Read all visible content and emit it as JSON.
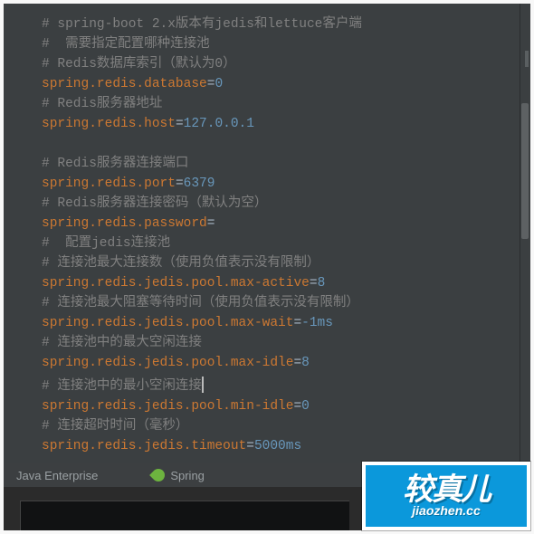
{
  "lines": [
    {
      "type": "comment",
      "text": "# spring-boot 2.x版本有jedis和lettuce客户端"
    },
    {
      "type": "comment",
      "text": "#  需要指定配置哪种连接池"
    },
    {
      "type": "comment",
      "text": "# Redis数据库索引（默认为0）"
    },
    {
      "type": "prop",
      "key": "spring.redis.database",
      "val": "0"
    },
    {
      "type": "comment",
      "text": "# Redis服务器地址"
    },
    {
      "type": "prop",
      "key": "spring.redis.host",
      "val": "127.0.0.1"
    },
    {
      "type": "blank"
    },
    {
      "type": "comment",
      "text": "# Redis服务器连接端口"
    },
    {
      "type": "prop",
      "key": "spring.redis.port",
      "val": "6379"
    },
    {
      "type": "comment",
      "text": "# Redis服务器连接密码（默认为空）"
    },
    {
      "type": "prop",
      "key": "spring.redis.password",
      "val": ""
    },
    {
      "type": "comment",
      "text": "#  配置jedis连接池"
    },
    {
      "type": "comment",
      "text": "# 连接池最大连接数（使用负值表示没有限制）"
    },
    {
      "type": "prop",
      "key": "spring.redis.jedis.pool.max-active",
      "val": "8"
    },
    {
      "type": "comment",
      "text": "# 连接池最大阻塞等待时间（使用负值表示没有限制）"
    },
    {
      "type": "prop",
      "key": "spring.redis.jedis.pool.max-wait",
      "val": "-1ms"
    },
    {
      "type": "comment",
      "text": "# 连接池中的最大空闲连接"
    },
    {
      "type": "prop",
      "key": "spring.redis.jedis.pool.max-idle",
      "val": "8"
    },
    {
      "type": "comment",
      "text": "# 连接池中的最小空闲连接",
      "caret": true
    },
    {
      "type": "prop",
      "key": "spring.redis.jedis.pool.min-idle",
      "val": "0"
    },
    {
      "type": "comment",
      "text": "# 连接超时时间（毫秒）"
    },
    {
      "type": "prop",
      "key": "spring.redis.jedis.timeout",
      "val": "5000ms"
    }
  ],
  "status": {
    "java": "Java Enterprise",
    "spring": "Spring"
  },
  "watermark": {
    "main": "较真儿",
    "sub": "jiaozhen.cc"
  }
}
